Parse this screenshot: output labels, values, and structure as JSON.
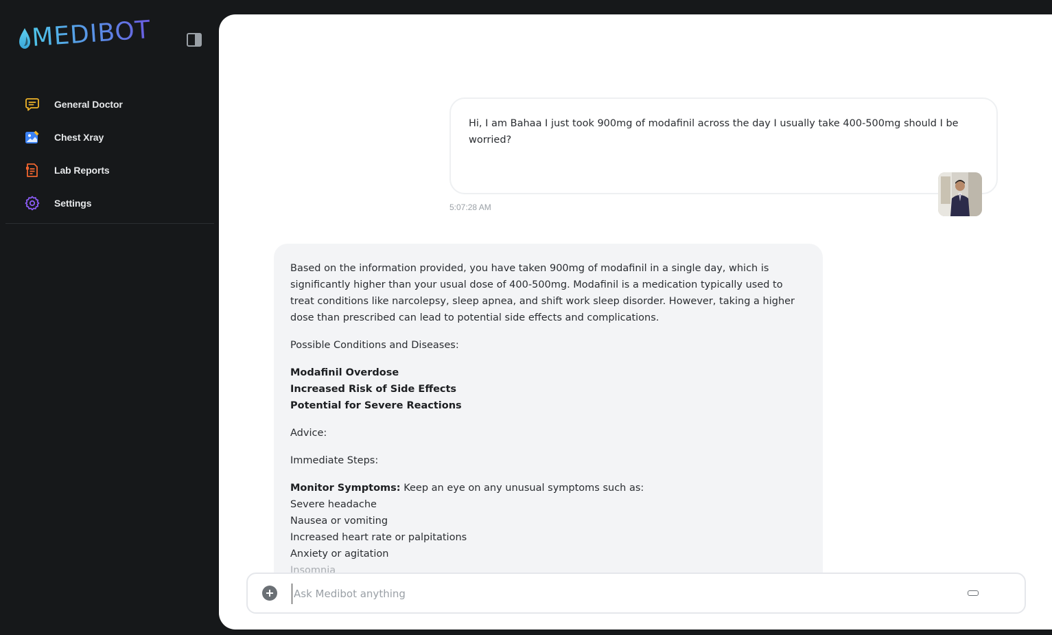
{
  "brand": {
    "name": "MEDIBOT"
  },
  "sidebar": {
    "items": [
      {
        "label": "General Doctor",
        "icon": "chat-icon",
        "color": "#f0b429"
      },
      {
        "label": "Chest Xray",
        "icon": "image-icon",
        "color": "#3b82f6"
      },
      {
        "label": "Lab Reports",
        "icon": "document-icon",
        "color": "#f0652f"
      },
      {
        "label": "Settings",
        "icon": "gear-icon",
        "color": "#8b5cf6"
      }
    ]
  },
  "chat": {
    "user_message": {
      "text": "Hi, I am Bahaa I just took 900mg of modafinil across the day I usually take 400-500mg should I be worried?",
      "time": "5:07:28 AM"
    },
    "bot_message": {
      "intro": "Based on the information provided, you have taken 900mg of modafinil in a single day, which is significantly higher than your usual dose of 400-500mg. Modafinil is a medication typically used to treat conditions like narcolepsy, sleep apnea, and shift work sleep disorder. However, taking a higher dose than prescribed can lead to potential side effects and complications.",
      "conditions_heading": "Possible Conditions and Diseases:",
      "conditions": [
        "Modafinil Overdose",
        "Increased Risk of Side Effects",
        "Potential for Severe Reactions"
      ],
      "advice_heading": "Advice:",
      "steps_heading": "Immediate Steps:",
      "monitor_label": "Monitor Symptoms:",
      "monitor_text": " Keep an eye on any unusual symptoms such as:",
      "symptoms": [
        "Severe headache",
        "Nausea or vomiting",
        "Increased heart rate or palpitations",
        "Anxiety or agitation"
      ],
      "cutoff_line": "Insomnia"
    }
  },
  "input": {
    "placeholder": "Ask Medibot anything",
    "value": ""
  },
  "colors": {
    "sidebar_bg": "#16181a",
    "main_bg": "#ffffff",
    "bot_bubble": "#f3f4f6"
  }
}
